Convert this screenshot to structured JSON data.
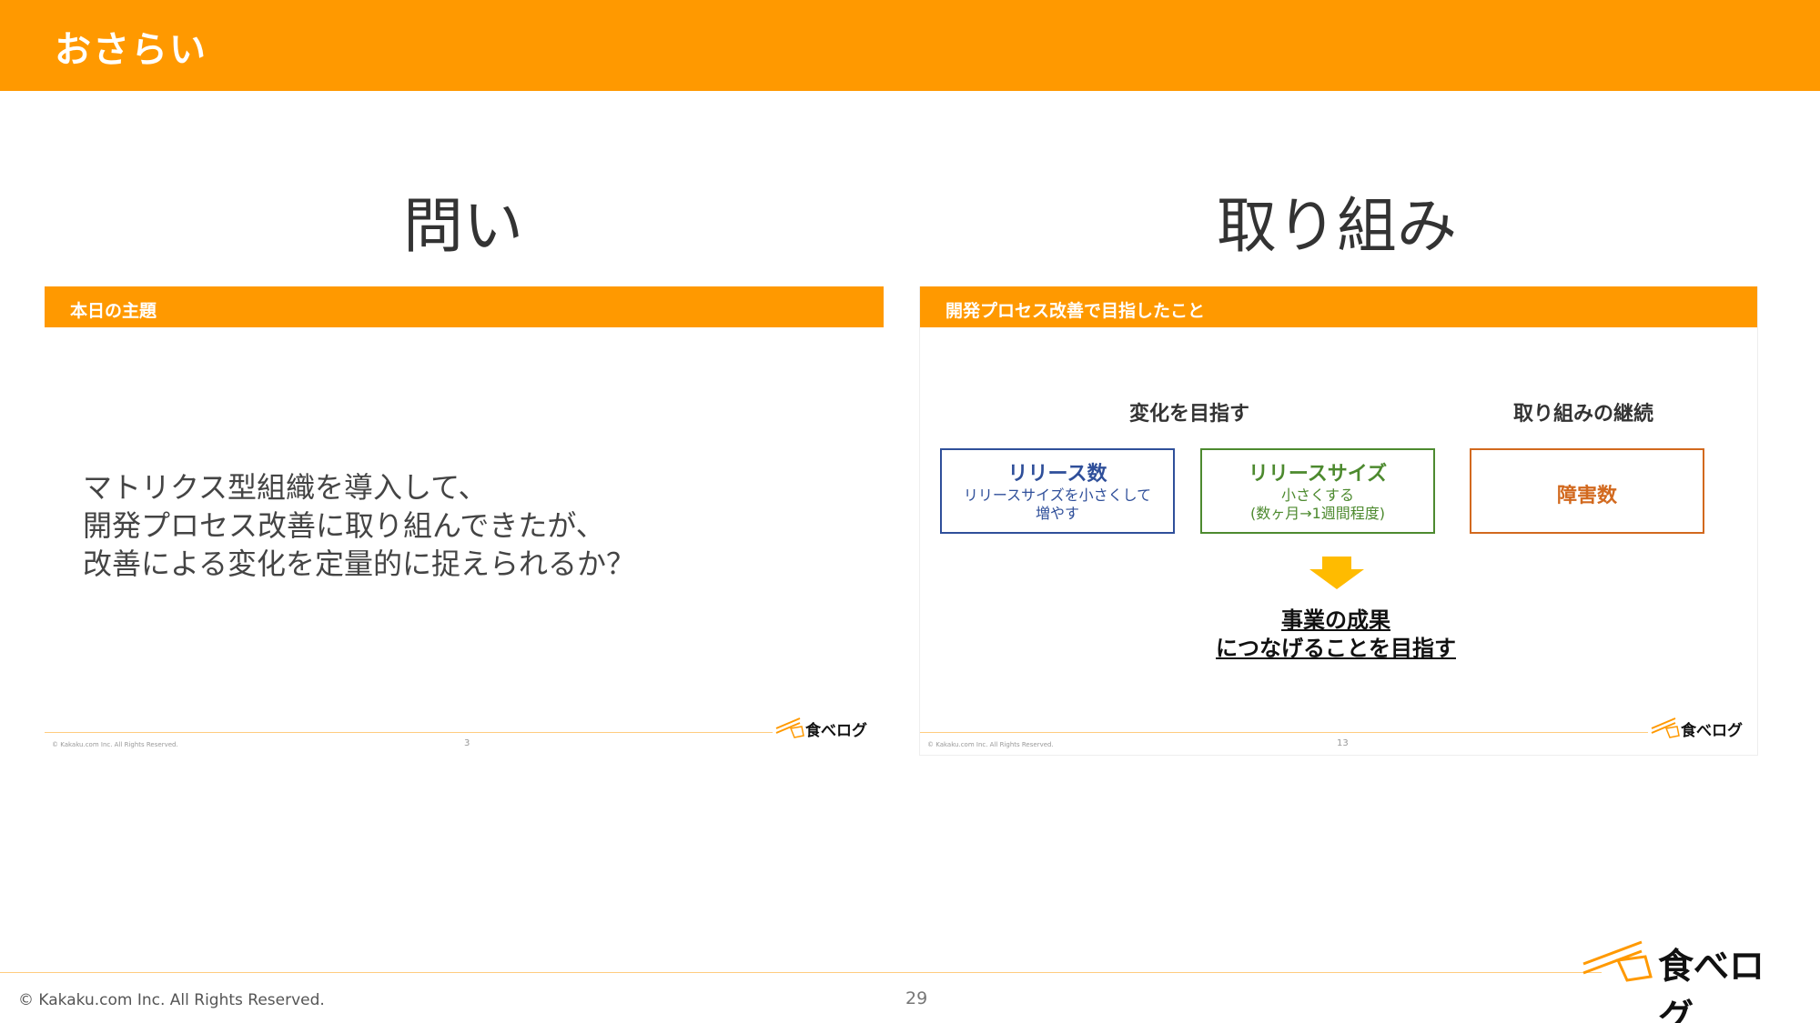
{
  "header": {
    "title": "おさらい"
  },
  "columns": {
    "left_heading": "問い",
    "right_heading": "取り組み"
  },
  "left_slide": {
    "bar_title": "本日の主題",
    "question": "マトリクス型組織を導入して、\n開発プロセス改善に取り組んできたが、\n改善による変化を定量的に捉えられるか？",
    "copyright": "© Kakaku.com Inc. All Rights Reserved.",
    "page": "3",
    "logo_text": "食べログ"
  },
  "right_slide": {
    "bar_title": "開発プロセス改善で目指したこと",
    "goal_change": "変化を目指す",
    "goal_continue": "取り組みの継続",
    "metrics": [
      {
        "title": "リリース数",
        "sub": "リリースサイズを小さくして\n増やす",
        "color": "#2f4f9a"
      },
      {
        "title": "リリースサイズ",
        "sub": "小さくする\n(数ヶ月→1週間程度)",
        "color": "#4d8a2f"
      },
      {
        "title": "障害数",
        "sub": "",
        "color": "#d2691e"
      }
    ],
    "conclusion": "事業の成果\nにつなげることを目指す",
    "copyright": "© Kakaku.com Inc. All Rights Reserved.",
    "page": "13",
    "logo_text": "食べログ"
  },
  "footer": {
    "copyright": "© Kakaku.com Inc. All Rights Reserved.",
    "page": "29",
    "logo_text": "食べログ"
  },
  "colors": {
    "accent": "#ff9900",
    "arrow": "#ffbb00"
  }
}
